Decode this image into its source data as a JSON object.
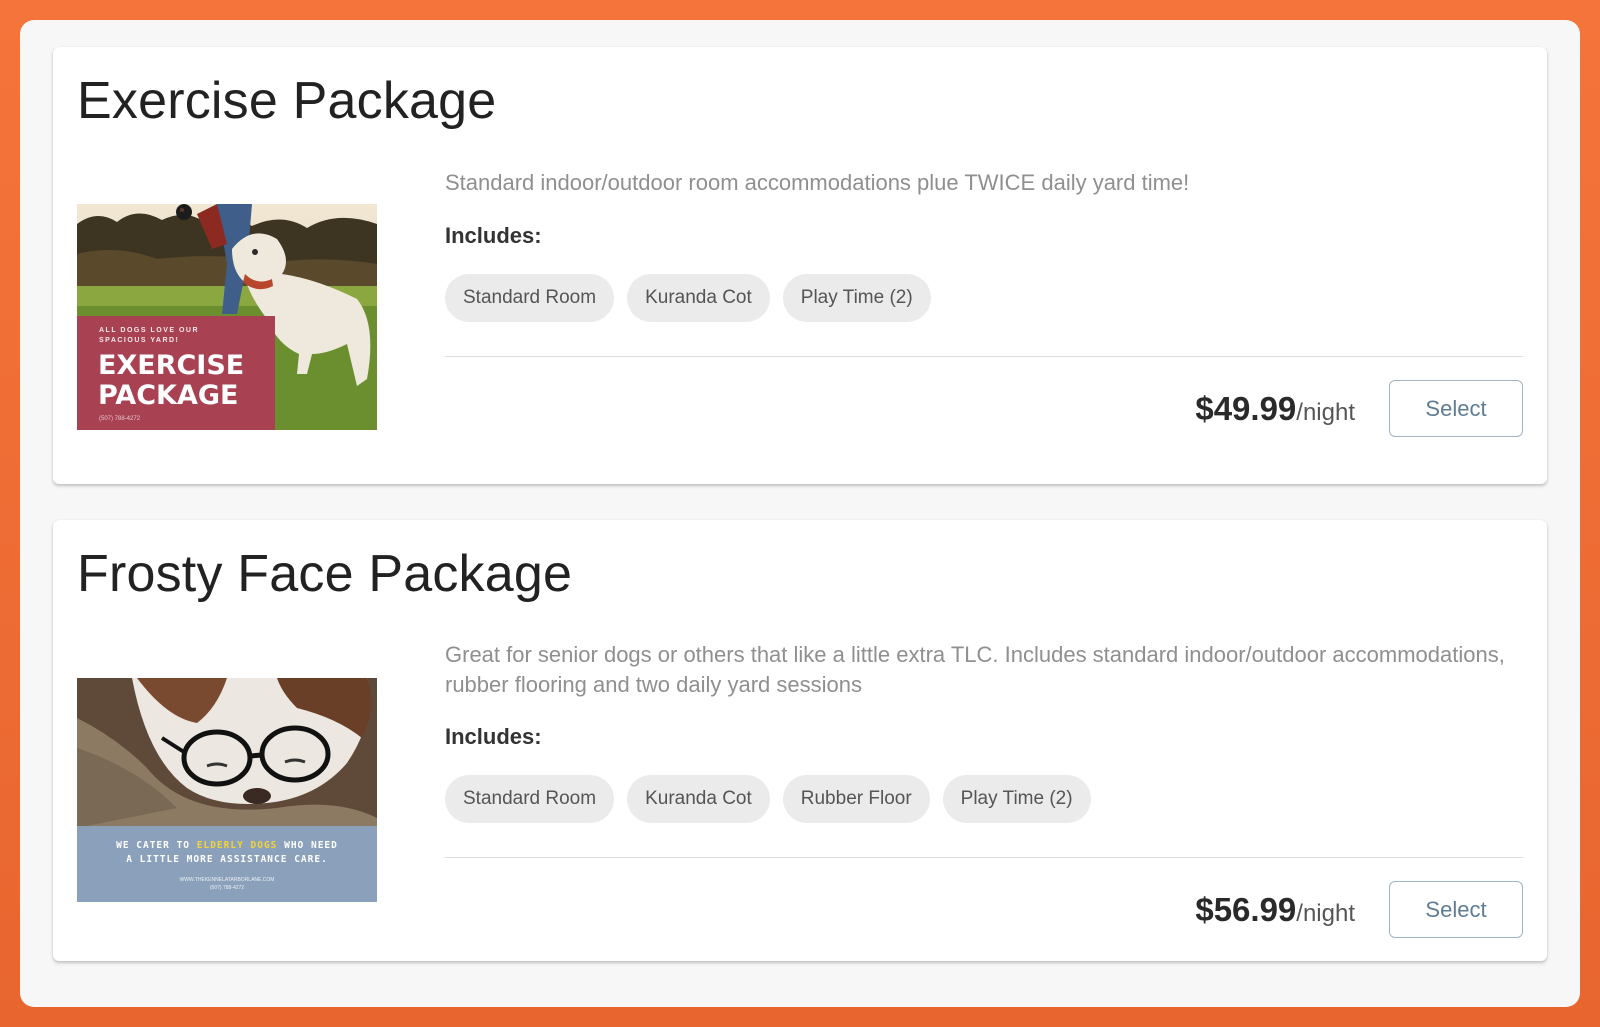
{
  "packages": [
    {
      "title": "Exercise Package",
      "description": "Standard indoor/outdoor room accommodations plue TWICE daily yard time!",
      "includes_label": "Includes:",
      "chips": [
        "Standard Room",
        "Kuranda Cot",
        "Play Time (2)"
      ],
      "price": "$49.99",
      "unit": "/night",
      "button": "Select",
      "image_text": {
        "small": [
          "ALL DOGS LOVE OUR",
          "SPACIOUS YARD!"
        ],
        "big": [
          "EXERCISE",
          "PACKAGE"
        ],
        "phone": "(507) 788-4272"
      }
    },
    {
      "title": "Frosty Face Package",
      "description": "Great for senior dogs or others that like a little extra TLC. Includes standard indoor/outdoor accommodations, rubber flooring and two daily yard sessions",
      "includes_label": "Includes:",
      "chips": [
        "Standard Room",
        "Kuranda Cot",
        "Rubber Floor",
        "Play Time (2)"
      ],
      "price": "$56.99",
      "unit": "/night",
      "button": "Select",
      "image_text": {
        "line1_pre": "WE CATER TO ",
        "line1_highlight": "ELDERLY DOGS",
        "line1_post": " WHO NEED",
        "line2": "A LITTLE MORE ASSISTANCE CARE.",
        "url": "WWW.THEKENNELATARBORLANE.COM",
        "phone": "(507) 788-4272"
      }
    }
  ],
  "colors": {
    "page_bg": "#f4743b",
    "accent_button": "#5f7c93",
    "image1_banner": "#a84152",
    "image2_banner": "#8ba0bb",
    "image2_highlight": "#f3d33a"
  }
}
